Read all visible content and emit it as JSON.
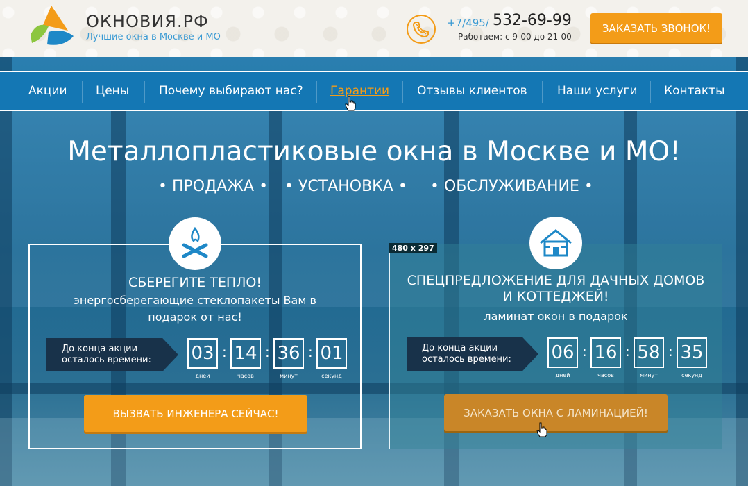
{
  "header": {
    "brand": "ОКНОВИЯ.РФ",
    "tagline": "Лучшие окна в Москве и МО",
    "phone_code": "+7/495/",
    "phone_number": "532-69-99",
    "work_hours": "Работаем: с 9-00 до 21-00",
    "call_button": "ЗАКАЗАТЬ ЗВОНОК!"
  },
  "nav": {
    "items": [
      {
        "label": "Акции"
      },
      {
        "label": "Цены"
      },
      {
        "label": "Почему выбирают нас?"
      },
      {
        "label": "Гарантии",
        "active": true
      },
      {
        "label": "Отзывы клиентов"
      },
      {
        "label": "Наши услуги"
      },
      {
        "label": "Контакты"
      }
    ]
  },
  "hero": {
    "headline": "Металлопластиковые окна в Москве и МО!",
    "services": [
      "• ПРОДАЖА •",
      "• УСТАНОВКА •",
      "• ОБСЛУЖИВАНИЕ •"
    ]
  },
  "cards": [
    {
      "icon": "campfire-icon",
      "title": "СБЕРЕГИТЕ ТЕПЛО!",
      "desc_line1": "энергосберегающие стеклопакеты Вам в",
      "desc_line2": "подарок от нас!",
      "timer_label_line1": "До конца акции",
      "timer_label_line2": "осталось времени:",
      "digits": [
        "03",
        "14",
        "36",
        "01"
      ],
      "units": [
        "дней",
        "часов",
        "минут",
        "секунд"
      ],
      "button": "ВЫЗВАТЬ ИНЖЕНЕРА СЕЙЧАС!"
    },
    {
      "icon": "house-icon",
      "title_line1": "СПЕЦПРЕДЛОЖЕНИЕ ДЛЯ ДАЧНЫХ ДОМОВ",
      "title_line2": "И КОТТЕДЖЕЙ!",
      "desc": "ламинат окон в подарок",
      "timer_label_line1": "До конца акции",
      "timer_label_line2": "осталось времени:",
      "digits": [
        "06",
        "16",
        "58",
        "35"
      ],
      "units": [
        "дней",
        "часов",
        "минут",
        "секунд"
      ],
      "button": "ЗАКАЗАТЬ ОКНА С ЛАМИНАЦИЕЙ!"
    }
  ],
  "overlay": {
    "size_badge": "480 x 297"
  },
  "colors": {
    "accent": "#f39c18",
    "nav_bg": "#1477b4",
    "link_blue": "#3a9ad3"
  }
}
